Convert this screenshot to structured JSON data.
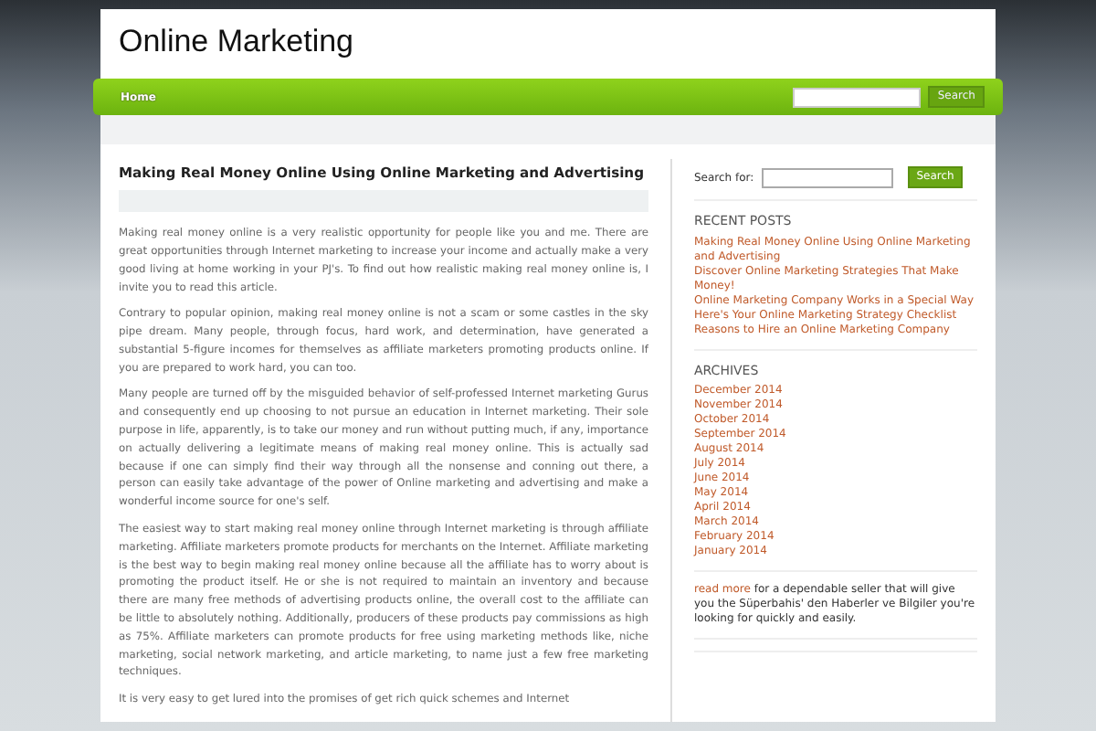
{
  "site_title": "Online Marketing",
  "nav": {
    "items": [
      {
        "label": "Home",
        "selected": true
      }
    ],
    "search_button": "Search"
  },
  "post": {
    "title": "Making Real Money Online Using Online Marketing and Advertising",
    "paragraphs": [
      "Making real money online is a very realistic opportunity for people like you and me. There are great opportunities through Internet marketing to increase your income and actually make a very good living at home working in your PJ's. To find out how realistic making real money online is, I invite you to read this article.",
      "Contrary to popular opinion, making real money online is not a scam or some castles in the sky pipe dream. Many people, through focus, hard work, and determination, have generated a substantial 5-figure incomes for themselves as affiliate marketers promoting products online. If you are prepared to work hard, you can too.",
      "Many people are turned off by the misguided behavior of self-professed Internet marketing Gurus and consequently end up choosing to not pursue an education in Internet marketing. Their sole purpose in life, apparently, is to take our money and run without putting much, if any, importance on actually delivering a legitimate means of making real money online. This is actually sad because if one can simply find their way through all the nonsense and conning out there, a person can easily take advantage of the power of Online marketing and advertising and make a wonderful income source for one's self.",
      "The easiest way to start making real money online through Internet marketing is through affiliate marketing. Affiliate marketers promote products for merchants on the Internet. Affiliate marketing is the best way to begin making real money online because all the affiliate has to worry about is promoting the product itself. He or she is not required to maintain an inventory and because there are many free methods of advertising products online, the overall cost to the affiliate can be little to absolutely nothing. Additionally, producers of these products pay commissions as high as 75%. Affiliate marketers can promote products for free using marketing methods like, niche marketing, social network marketing, and article marketing, to name just a few free marketing techniques.",
      "It is very easy to get lured into the promises of get rich quick schemes and Internet"
    ]
  },
  "sidebar": {
    "search_label": "Search for:",
    "search_button": "Search",
    "recent_heading": "RECENT POSTS",
    "recent_posts": [
      "Making Real Money Online Using Online Marketing and Advertising",
      "Discover Online Marketing Strategies That Make Money!",
      "Online Marketing Company Works in a Special Way",
      "Here's Your Online Marketing Strategy Checklist",
      "Reasons to Hire an Online Marketing Company"
    ],
    "archives_heading": "ARCHIVES",
    "archives": [
      "December 2014",
      "November 2014",
      "October 2014",
      "September 2014",
      "August 2014",
      "July 2014",
      "June 2014",
      "May 2014",
      "April 2014",
      "March 2014",
      "February 2014",
      "January 2014"
    ],
    "promo": {
      "link": "read more",
      "text": " for a dependable seller that will give you the Süperbahis' den Haberler ve Bilgiler you're looking for quickly and easily."
    }
  }
}
